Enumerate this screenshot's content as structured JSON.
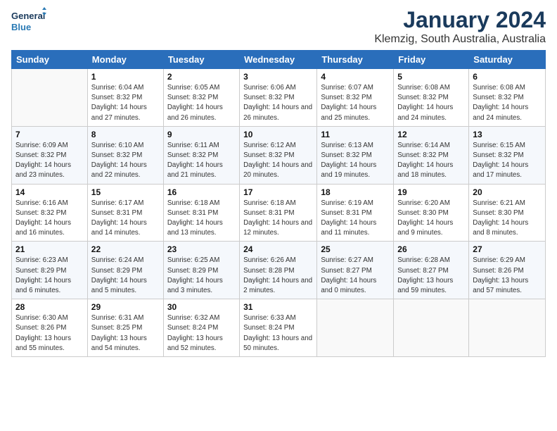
{
  "header": {
    "logo_general": "General",
    "logo_blue": "Blue",
    "title": "January 2024",
    "subtitle": "Klemzig, South Australia, Australia"
  },
  "weekdays": [
    "Sunday",
    "Monday",
    "Tuesday",
    "Wednesday",
    "Thursday",
    "Friday",
    "Saturday"
  ],
  "weeks": [
    [
      {
        "day": "",
        "sunrise": "",
        "sunset": "",
        "daylight": ""
      },
      {
        "day": "1",
        "sunrise": "Sunrise: 6:04 AM",
        "sunset": "Sunset: 8:32 PM",
        "daylight": "Daylight: 14 hours and 27 minutes."
      },
      {
        "day": "2",
        "sunrise": "Sunrise: 6:05 AM",
        "sunset": "Sunset: 8:32 PM",
        "daylight": "Daylight: 14 hours and 26 minutes."
      },
      {
        "day": "3",
        "sunrise": "Sunrise: 6:06 AM",
        "sunset": "Sunset: 8:32 PM",
        "daylight": "Daylight: 14 hours and 26 minutes."
      },
      {
        "day": "4",
        "sunrise": "Sunrise: 6:07 AM",
        "sunset": "Sunset: 8:32 PM",
        "daylight": "Daylight: 14 hours and 25 minutes."
      },
      {
        "day": "5",
        "sunrise": "Sunrise: 6:08 AM",
        "sunset": "Sunset: 8:32 PM",
        "daylight": "Daylight: 14 hours and 24 minutes."
      },
      {
        "day": "6",
        "sunrise": "Sunrise: 6:08 AM",
        "sunset": "Sunset: 8:32 PM",
        "daylight": "Daylight: 14 hours and 24 minutes."
      }
    ],
    [
      {
        "day": "7",
        "sunrise": "Sunrise: 6:09 AM",
        "sunset": "Sunset: 8:32 PM",
        "daylight": "Daylight: 14 hours and 23 minutes."
      },
      {
        "day": "8",
        "sunrise": "Sunrise: 6:10 AM",
        "sunset": "Sunset: 8:32 PM",
        "daylight": "Daylight: 14 hours and 22 minutes."
      },
      {
        "day": "9",
        "sunrise": "Sunrise: 6:11 AM",
        "sunset": "Sunset: 8:32 PM",
        "daylight": "Daylight: 14 hours and 21 minutes."
      },
      {
        "day": "10",
        "sunrise": "Sunrise: 6:12 AM",
        "sunset": "Sunset: 8:32 PM",
        "daylight": "Daylight: 14 hours and 20 minutes."
      },
      {
        "day": "11",
        "sunrise": "Sunrise: 6:13 AM",
        "sunset": "Sunset: 8:32 PM",
        "daylight": "Daylight: 14 hours and 19 minutes."
      },
      {
        "day": "12",
        "sunrise": "Sunrise: 6:14 AM",
        "sunset": "Sunset: 8:32 PM",
        "daylight": "Daylight: 14 hours and 18 minutes."
      },
      {
        "day": "13",
        "sunrise": "Sunrise: 6:15 AM",
        "sunset": "Sunset: 8:32 PM",
        "daylight": "Daylight: 14 hours and 17 minutes."
      }
    ],
    [
      {
        "day": "14",
        "sunrise": "Sunrise: 6:16 AM",
        "sunset": "Sunset: 8:32 PM",
        "daylight": "Daylight: 14 hours and 16 minutes."
      },
      {
        "day": "15",
        "sunrise": "Sunrise: 6:17 AM",
        "sunset": "Sunset: 8:31 PM",
        "daylight": "Daylight: 14 hours and 14 minutes."
      },
      {
        "day": "16",
        "sunrise": "Sunrise: 6:18 AM",
        "sunset": "Sunset: 8:31 PM",
        "daylight": "Daylight: 14 hours and 13 minutes."
      },
      {
        "day": "17",
        "sunrise": "Sunrise: 6:18 AM",
        "sunset": "Sunset: 8:31 PM",
        "daylight": "Daylight: 14 hours and 12 minutes."
      },
      {
        "day": "18",
        "sunrise": "Sunrise: 6:19 AM",
        "sunset": "Sunset: 8:31 PM",
        "daylight": "Daylight: 14 hours and 11 minutes."
      },
      {
        "day": "19",
        "sunrise": "Sunrise: 6:20 AM",
        "sunset": "Sunset: 8:30 PM",
        "daylight": "Daylight: 14 hours and 9 minutes."
      },
      {
        "day": "20",
        "sunrise": "Sunrise: 6:21 AM",
        "sunset": "Sunset: 8:30 PM",
        "daylight": "Daylight: 14 hours and 8 minutes."
      }
    ],
    [
      {
        "day": "21",
        "sunrise": "Sunrise: 6:23 AM",
        "sunset": "Sunset: 8:29 PM",
        "daylight": "Daylight: 14 hours and 6 minutes."
      },
      {
        "day": "22",
        "sunrise": "Sunrise: 6:24 AM",
        "sunset": "Sunset: 8:29 PM",
        "daylight": "Daylight: 14 hours and 5 minutes."
      },
      {
        "day": "23",
        "sunrise": "Sunrise: 6:25 AM",
        "sunset": "Sunset: 8:29 PM",
        "daylight": "Daylight: 14 hours and 3 minutes."
      },
      {
        "day": "24",
        "sunrise": "Sunrise: 6:26 AM",
        "sunset": "Sunset: 8:28 PM",
        "daylight": "Daylight: 14 hours and 2 minutes."
      },
      {
        "day": "25",
        "sunrise": "Sunrise: 6:27 AM",
        "sunset": "Sunset: 8:27 PM",
        "daylight": "Daylight: 14 hours and 0 minutes."
      },
      {
        "day": "26",
        "sunrise": "Sunrise: 6:28 AM",
        "sunset": "Sunset: 8:27 PM",
        "daylight": "Daylight: 13 hours and 59 minutes."
      },
      {
        "day": "27",
        "sunrise": "Sunrise: 6:29 AM",
        "sunset": "Sunset: 8:26 PM",
        "daylight": "Daylight: 13 hours and 57 minutes."
      }
    ],
    [
      {
        "day": "28",
        "sunrise": "Sunrise: 6:30 AM",
        "sunset": "Sunset: 8:26 PM",
        "daylight": "Daylight: 13 hours and 55 minutes."
      },
      {
        "day": "29",
        "sunrise": "Sunrise: 6:31 AM",
        "sunset": "Sunset: 8:25 PM",
        "daylight": "Daylight: 13 hours and 54 minutes."
      },
      {
        "day": "30",
        "sunrise": "Sunrise: 6:32 AM",
        "sunset": "Sunset: 8:24 PM",
        "daylight": "Daylight: 13 hours and 52 minutes."
      },
      {
        "day": "31",
        "sunrise": "Sunrise: 6:33 AM",
        "sunset": "Sunset: 8:24 PM",
        "daylight": "Daylight: 13 hours and 50 minutes."
      },
      {
        "day": "",
        "sunrise": "",
        "sunset": "",
        "daylight": ""
      },
      {
        "day": "",
        "sunrise": "",
        "sunset": "",
        "daylight": ""
      },
      {
        "day": "",
        "sunrise": "",
        "sunset": "",
        "daylight": ""
      }
    ]
  ]
}
